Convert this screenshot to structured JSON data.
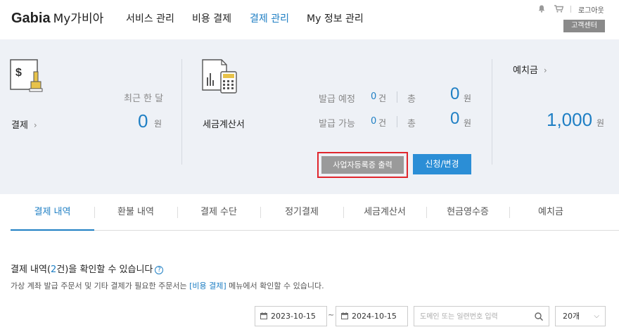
{
  "header": {
    "logo_brand": "Gabia",
    "logo_sub": "My가비아",
    "nav": [
      {
        "label": "서비스 관리",
        "active": false
      },
      {
        "label": "비용 결제",
        "active": false
      },
      {
        "label": "결제 관리",
        "active": true
      },
      {
        "label": "My 정보 관리",
        "active": false
      }
    ],
    "logout": "로그아웃",
    "customer_center": "고객센터"
  },
  "summary": {
    "payment": {
      "label": "결제",
      "recent_label": "최근 한 달",
      "amount": "0",
      "unit": "원"
    },
    "tax_invoice": {
      "label": "세금계산서",
      "scheduled_label": "발급 예정",
      "scheduled_count": "0",
      "scheduled_total": "0",
      "available_label": "발급 가능",
      "available_count": "0",
      "available_total": "0",
      "count_unit": "건",
      "total_label": "총",
      "unit": "원",
      "print_button": "사업자등록증 출력",
      "apply_button": "신청/변경"
    },
    "deposit": {
      "label": "예치금",
      "amount": "1,000",
      "unit": "원"
    }
  },
  "tabs": [
    {
      "label": "결제 내역",
      "active": true
    },
    {
      "label": "환불 내역",
      "active": false
    },
    {
      "label": "결제 수단",
      "active": false
    },
    {
      "label": "정기결제",
      "active": false
    },
    {
      "label": "세금계산서",
      "active": false
    },
    {
      "label": "현금영수증",
      "active": false
    },
    {
      "label": "예치금",
      "active": false
    }
  ],
  "content": {
    "title_prefix": "결제 내역(",
    "title_count": "2",
    "title_suffix": "건)을 확인할 수 있습니다",
    "help": "?",
    "desc_prefix": "가상 계좌 발급 주문서 및 기타 결제가 필요한 주문서는 ",
    "desc_link": "[비용 결제]",
    "desc_suffix": " 메뉴에서 확인할 수 있습니다.",
    "date_from": "2023-10-15",
    "date_to": "2024-10-15",
    "date_sep": "~",
    "search_placeholder": "도메인 또는 일련번호 입력",
    "page_size": "20개"
  },
  "colors": {
    "accent": "#1f7fc4",
    "panel_bg": "#eef1f6",
    "highlight_border": "#e0262d"
  }
}
